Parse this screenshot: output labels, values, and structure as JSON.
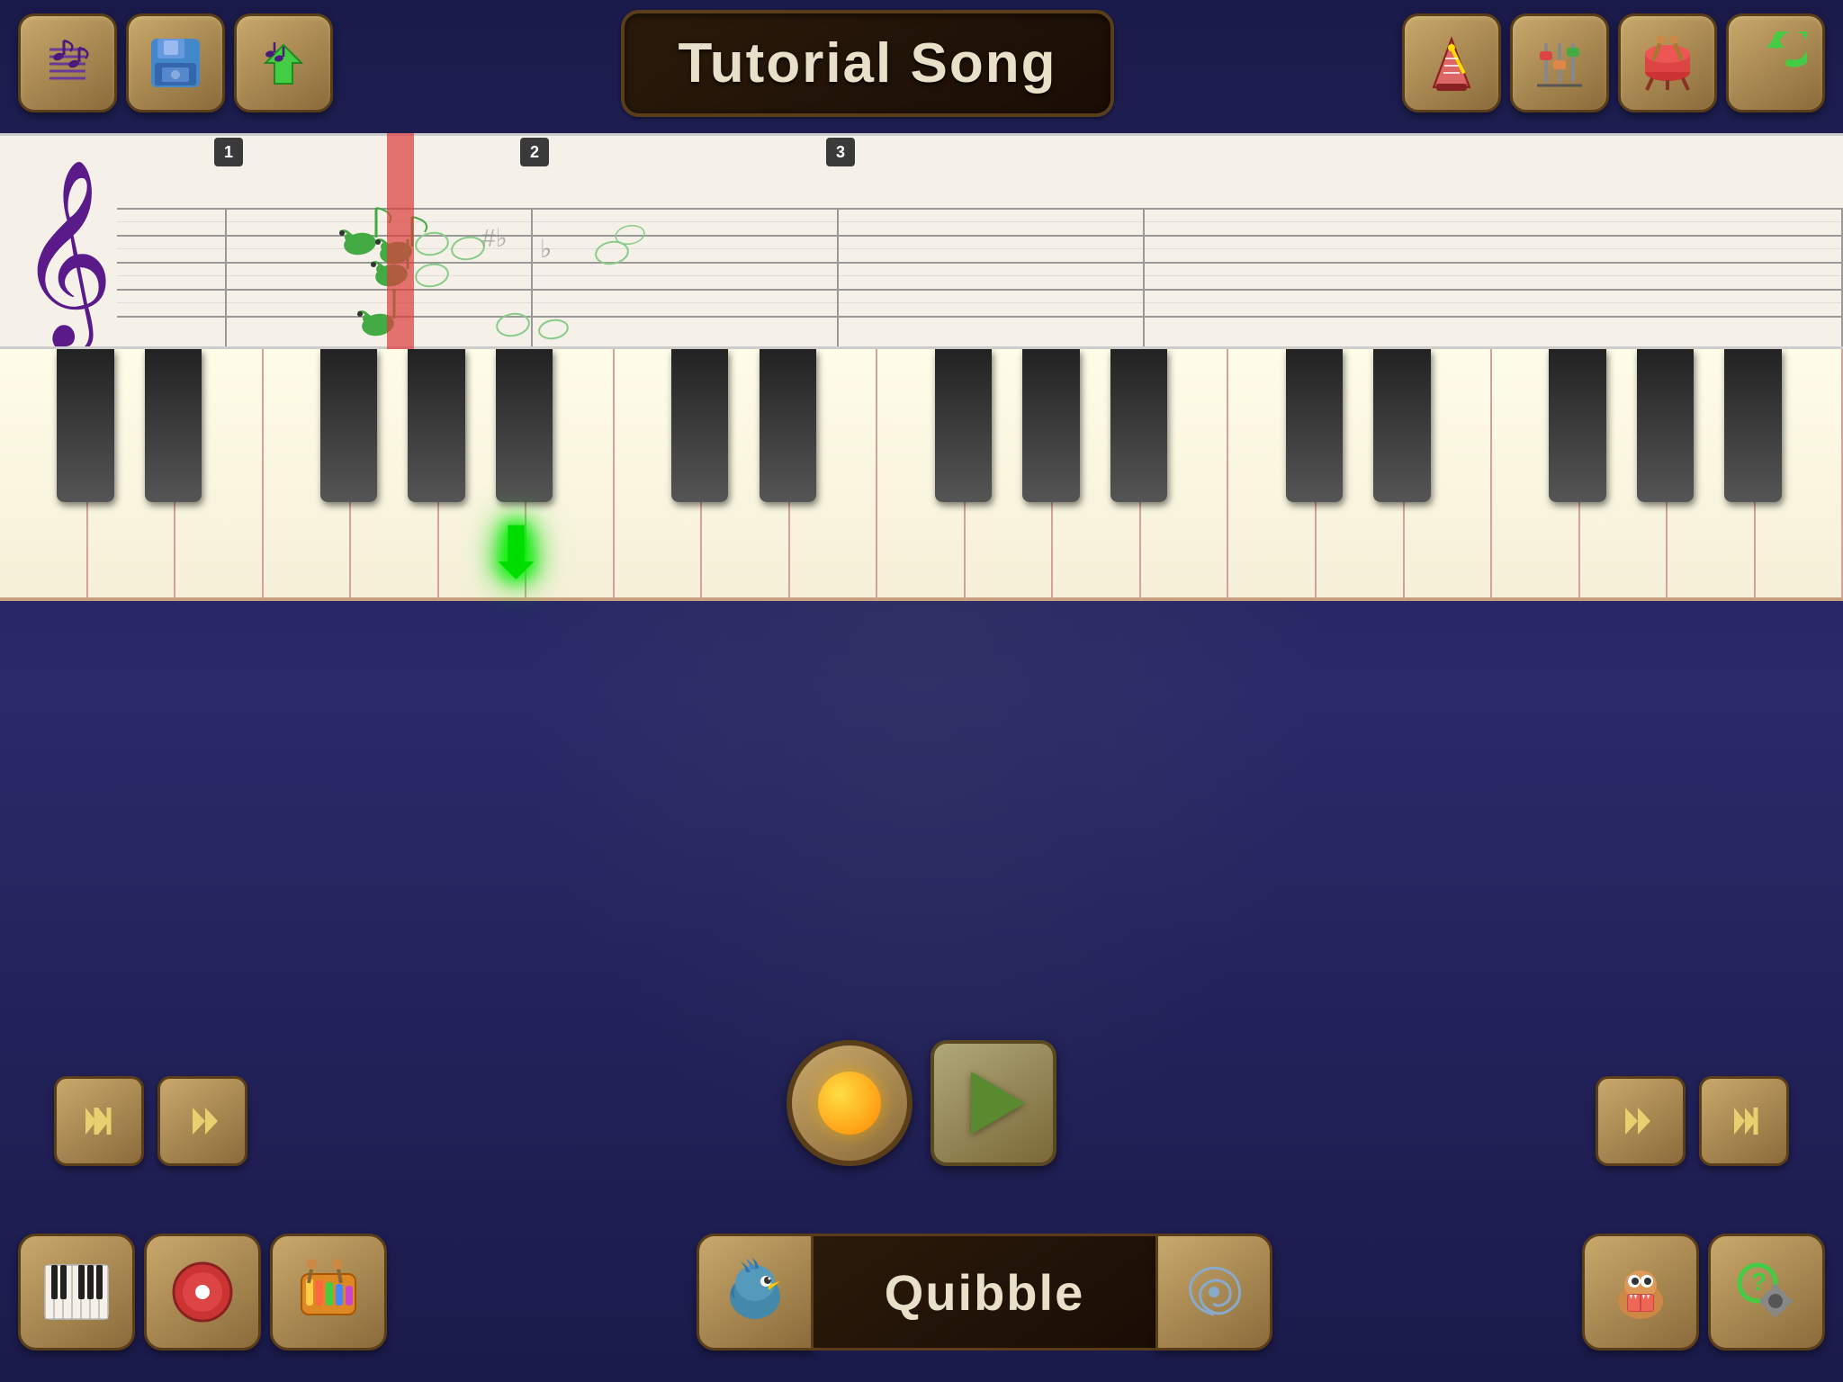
{
  "title": "Tutorial Song",
  "toolbar": {
    "left_buttons": [
      {
        "id": "music-notes",
        "icon": "🎵",
        "label": "Music Notes"
      },
      {
        "id": "save",
        "icon": "💾",
        "label": "Save"
      },
      {
        "id": "load",
        "icon": "📂",
        "label": "Load"
      }
    ],
    "right_buttons": [
      {
        "id": "metronome",
        "icon": "🔔",
        "label": "Metronome"
      },
      {
        "id": "mixer",
        "icon": "🎛️",
        "label": "Mixer"
      },
      {
        "id": "tempo",
        "icon": "🥁",
        "label": "Tempo"
      },
      {
        "id": "undo",
        "icon": "↩️",
        "label": "Undo"
      }
    ]
  },
  "sheet": {
    "measure_numbers": [
      1,
      2,
      3
    ],
    "measure_positions": [
      252,
      590,
      930
    ]
  },
  "transport": {
    "left_buttons": [
      {
        "id": "rewind-start",
        "icon": "⏮",
        "label": "Rewind to Start"
      },
      {
        "id": "rewind",
        "icon": "⏪",
        "label": "Rewind"
      }
    ],
    "center_buttons": [
      {
        "id": "record",
        "label": "Record"
      },
      {
        "id": "play",
        "label": "Play"
      }
    ],
    "right_buttons": [
      {
        "id": "fast-forward",
        "icon": "⏩",
        "label": "Fast Forward"
      },
      {
        "id": "skip-end",
        "icon": "⏭",
        "label": "Skip to End"
      }
    ]
  },
  "bottom_toolbar": {
    "left_buttons": [
      {
        "id": "piano-keys",
        "icon": "🎹",
        "label": "Piano"
      },
      {
        "id": "record-mode",
        "icon": "⭕",
        "label": "Record Mode"
      },
      {
        "id": "instruments",
        "icon": "🎺",
        "label": "Instruments"
      }
    ],
    "character": {
      "name": "Quibble",
      "avatar_icon": "🦜"
    },
    "right_buttons": [
      {
        "id": "monsters",
        "icon": "👾",
        "label": "Monsters"
      },
      {
        "id": "settings",
        "icon": "❓",
        "label": "Help/Settings"
      }
    ]
  },
  "piano": {
    "white_key_count": 21,
    "colors": {
      "white_key": "#fffce8",
      "black_key": "#222222",
      "border": "#d4a0a0"
    }
  },
  "colors": {
    "background": "#2a2a5a",
    "toolbar_btn": "#c8a86b",
    "toolbar_btn_dark": "#8b6b3a",
    "toolbar_border": "#5a3e1a",
    "title_bg": "#2a1a0a",
    "sheet_bg": "#f5f0e8",
    "playhead": "rgba(220,60,60,0.7)",
    "treble_clef": "#5a1a8a",
    "green_arrow": "#00dd00"
  }
}
